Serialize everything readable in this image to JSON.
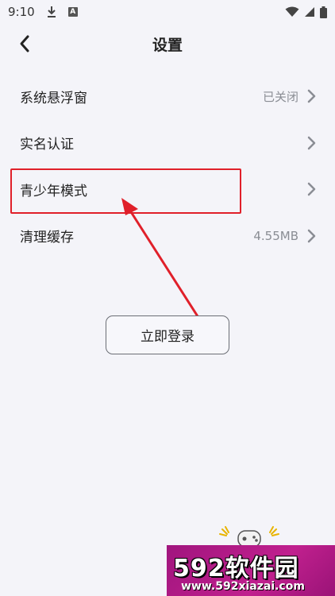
{
  "status_bar": {
    "time": "9:10",
    "a_icon_text": "A",
    "icons": [
      "download-icon",
      "a-icon",
      "wifi-icon",
      "signal-icon",
      "battery-icon"
    ]
  },
  "header": {
    "title": "设置",
    "back_icon": "chevron-left-icon"
  },
  "settings": [
    {
      "label": "系统悬浮窗",
      "value": "已关闭"
    },
    {
      "label": "实名认证",
      "value": ""
    },
    {
      "label": "青少年模式",
      "value": ""
    },
    {
      "label": "清理缓存",
      "value": "4.55MB"
    }
  ],
  "login_button": "立即登录",
  "annotation": {
    "color": "#e0202a"
  },
  "watermark": {
    "brand": "592软件园",
    "url": "www.592xiazai.com"
  },
  "colors": {
    "background": "#f4f4f9",
    "text": "#222222",
    "secondary_text": "#8a8d94",
    "watermark_bg": "#b01a86"
  }
}
